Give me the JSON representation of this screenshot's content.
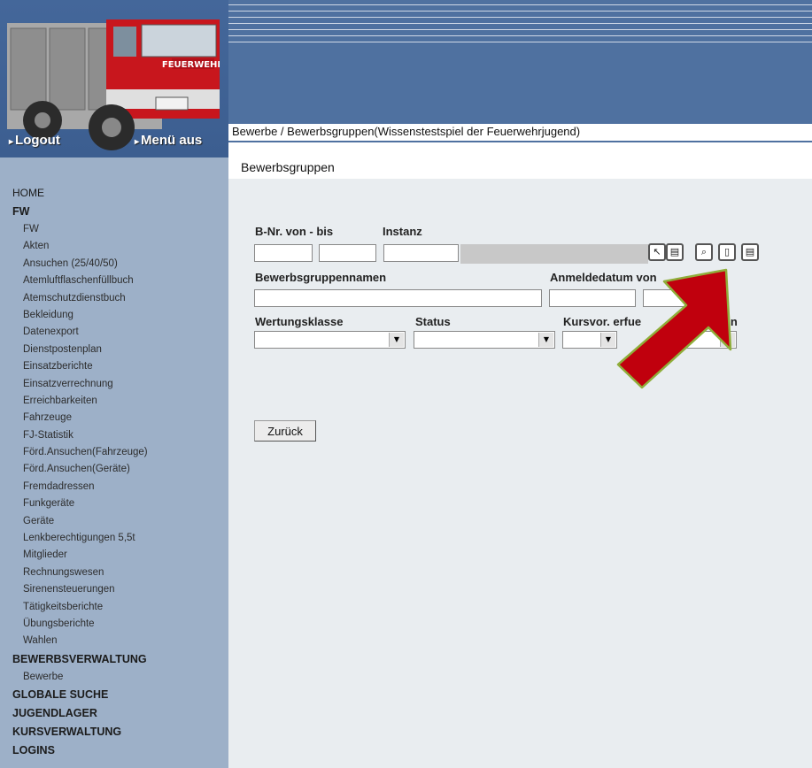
{
  "header": {
    "logout_label": "Logout",
    "menu_label": "Menü aus",
    "breadcrumb": "Bewerbe / Bewerbsgruppen(Wissenstestspiel der Feuerwehrjugend)",
    "truck_lettering": "FEUERWEHR"
  },
  "sidebar": {
    "home": "HOME",
    "fw_section": "FW",
    "fw_items": [
      "FW",
      "Akten",
      "Ansuchen (25/40/50)",
      "Atemluftflaschenfüllbuch",
      "Atemschutzdienstbuch",
      "Bekleidung",
      "Datenexport",
      "Dienstpostenplan",
      "Einsatzberichte",
      "Einsatzverrechnung",
      "Erreichbarkeiten",
      "Fahrzeuge",
      "FJ-Statistik",
      "Förd.Ansuchen(Fahrzeuge)",
      "Förd.Ansuchen(Geräte)",
      "Fremdadressen",
      "Funkgeräte",
      "Geräte",
      "Lenkberechtigungen 5,5t",
      "Mitglieder",
      "Rechnungswesen",
      "Sirenensteuerungen",
      "Tätigkeitsberichte",
      "Übungsberichte",
      "Wahlen"
    ],
    "bewerbsverwaltung": "BEWERBSVERWALTUNG",
    "bewerbe": "Bewerbe",
    "globale_suche": "GLOBALE SUCHE",
    "jugendlager": "JUGENDLAGER",
    "kursverwaltung": "KURSVERWALTUNG",
    "logins": "LOGINS"
  },
  "main": {
    "title": "Bewerbsgruppen",
    "labels": {
      "bnr": "B-Nr. von - bis",
      "instanz": "Instanz",
      "gruppenname": "Bewerbsgruppennamen",
      "anmeldedatum": "Anmeldedatum von",
      "wertungsklasse": "Wertungsklasse",
      "status": "Status",
      "kursvor": "Kursvor. erfue",
      "zeiten": "zeiten"
    },
    "toolbar_icons": [
      "cursor-icon",
      "list-icon",
      "search-icon",
      "new-document-icon",
      "details-icon"
    ],
    "back_label": "Zurück"
  },
  "colors": {
    "header_blue": "#4f71a0",
    "sidebar_bg": "#9db0c8",
    "content_bg": "#e9edf0",
    "arrow_red": "#c0000d",
    "arrow_outline": "#8fae3a"
  }
}
